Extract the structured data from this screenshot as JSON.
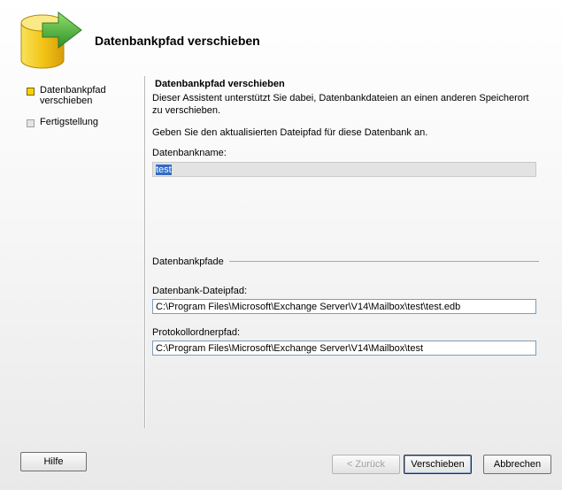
{
  "header": {
    "title": "Datenbankpfad verschieben"
  },
  "steps": [
    {
      "label": "Datenbankpfad verschieben",
      "state": "current"
    },
    {
      "label": "Fertigstellung",
      "state": "pending"
    }
  ],
  "content": {
    "section_title": "Datenbankpfad verschieben",
    "description": "Dieser Assistent unterstützt Sie dabei, Datenbankdateien an einen anderen Speicherort zu verschieben.",
    "prompt": "Geben Sie den aktualisierten Dateipfad für diese Datenbank an.",
    "db_name_label": "Datenbankname:",
    "db_name_value": "test",
    "group_label": "Datenbankpfade",
    "db_file_label": "Datenbank-Dateipfad:",
    "db_file_value": "C:\\Program Files\\Microsoft\\Exchange Server\\V14\\Mailbox\\test\\test.edb",
    "log_folder_label": "Protokollordnerpfad:",
    "log_folder_value": "C:\\Program Files\\Microsoft\\Exchange Server\\V14\\Mailbox\\test"
  },
  "buttons": {
    "help": "Hilfe",
    "back": "< Zurück",
    "move": "Verschieben",
    "cancel": "Abbrechen"
  },
  "colors": {
    "selection": "#316ac5",
    "icon_yellow": "#f2d21a",
    "icon_green": "#3da83a"
  }
}
